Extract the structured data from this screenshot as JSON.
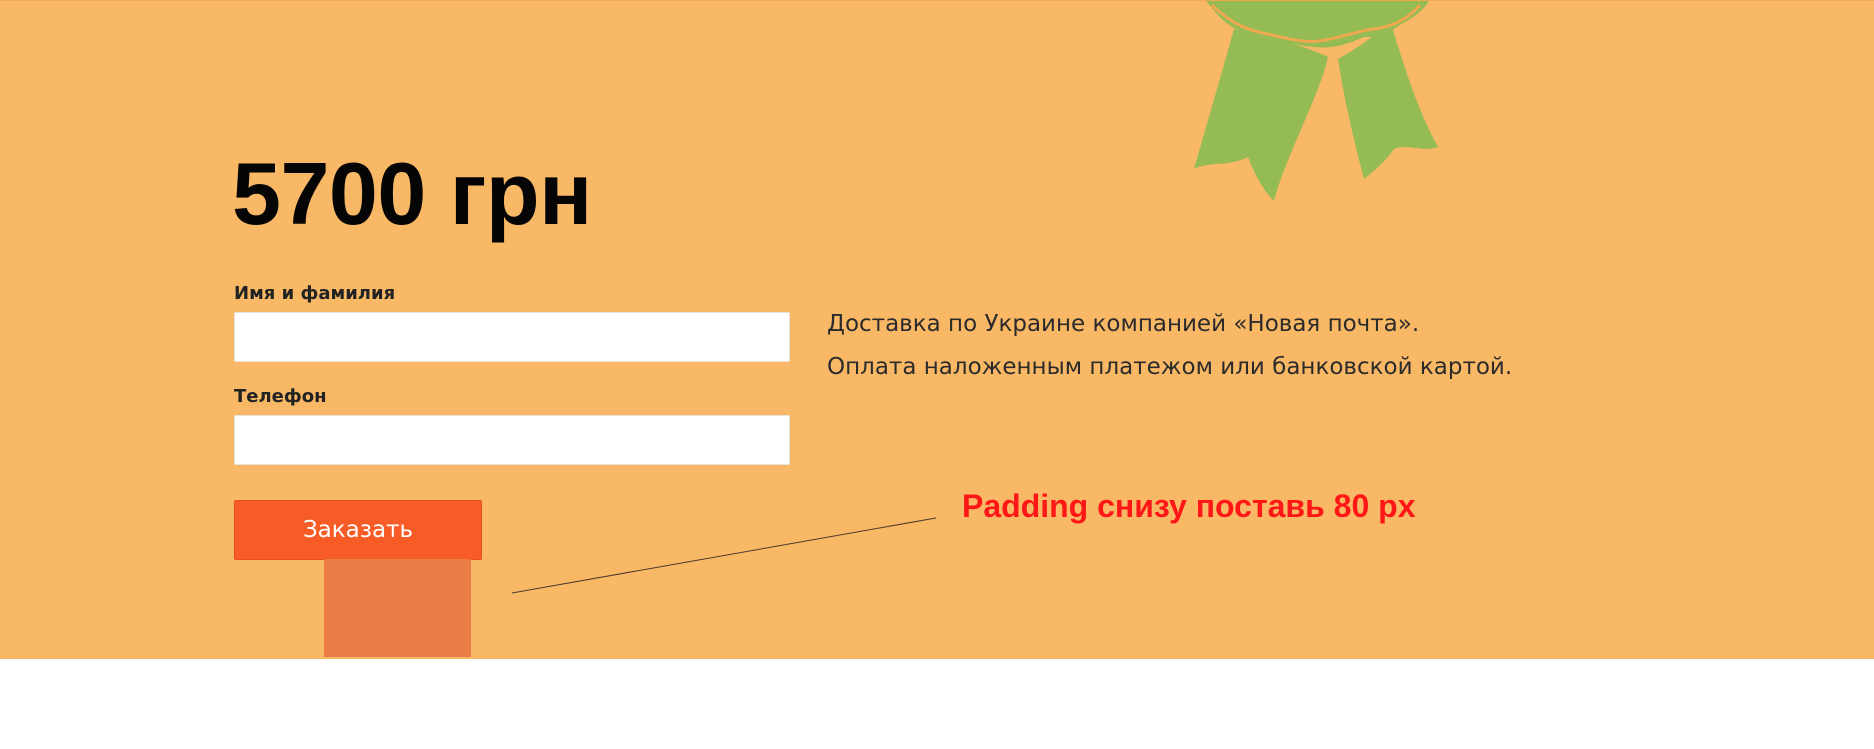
{
  "order": {
    "price": "5700 грн",
    "form": {
      "name_label": "Имя и фамилия",
      "name_value": "",
      "phone_label": "Телефон",
      "phone_value": "",
      "submit_label": "Заказать"
    },
    "delivery_lines": [
      "Доставка по Украине компанией «Новая почта».",
      "Оплата наложенным платежом или банковской картой."
    ]
  },
  "annotation": {
    "text": "Padding снизу поставь 80 px",
    "color": "#ff1616"
  },
  "colors": {
    "section_background": "#f8b865",
    "button_background": "#f85c26",
    "ribbon_green": "#95bb55",
    "padding_marker": "#ec7c45"
  },
  "icons": {
    "decoration": "award-ribbon-icon"
  }
}
